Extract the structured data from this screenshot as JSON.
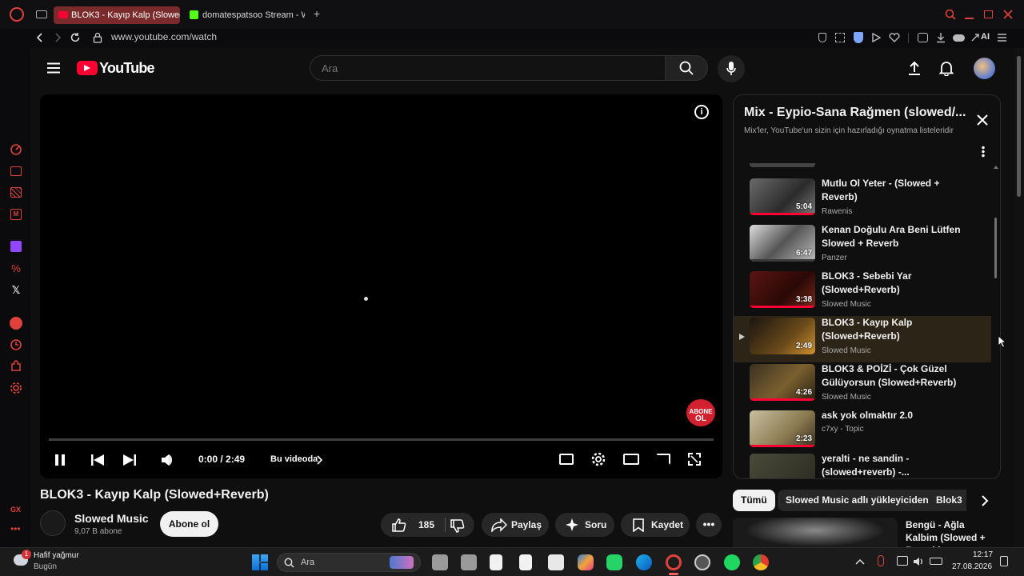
{
  "browser": {
    "tabs": [
      {
        "label": "BLOK3 - Kayıp Kalp (Slowed",
        "active": true
      },
      {
        "label": "domatespatsoo Stream - W",
        "active": false
      }
    ],
    "url": "www.youtube.com/watch",
    "ai_label": "AI"
  },
  "youtube": {
    "logo_text": "YouTube",
    "search_placeholder": "Ara"
  },
  "player": {
    "time": "0:00 / 2:49",
    "chapter_label": "Bu videoda",
    "watermark_line1": "ABONE",
    "watermark_line2": "OL"
  },
  "video": {
    "title": "BLOK3 - Kayıp Kalp (Slowed+Reverb)",
    "channel": "Slowed Music",
    "subscribers": "9,07 B abone",
    "subscribe_label": "Abone ol",
    "likes": "185",
    "share_label": "Paylaş",
    "ask_label": "Soru",
    "save_label": "Kaydet"
  },
  "playlist": {
    "title": "Mix - Eypio-Sana Rağmen (slowed/...",
    "subtitle": "Mix'ler, YouTube'un sizin için hazırladığı oynatma listeleridir",
    "items": [
      {
        "title": "Mutlu Ol Yeter - (Slowed + Reverb)",
        "channel": "Rawenis",
        "duration": "5:04",
        "current": false
      },
      {
        "title": "Kenan Doğulu Ara Beni Lütfen Slowed + Reverb",
        "channel": "Panzer",
        "duration": "6:47",
        "current": false
      },
      {
        "title": "BLOK3 - Sebebi Yar (Slowed+Reverb)",
        "channel": "Slowed Music",
        "duration": "3:38",
        "current": false
      },
      {
        "title": "BLOK3 - Kayıp Kalp (Slowed+Reverb)",
        "channel": "Slowed Music",
        "duration": "2:49",
        "current": true
      },
      {
        "title": "BLOK3 & POİZİ - Çok Güzel Gülüyorsun (Slowed+Reverb)",
        "channel": "Slowed Music",
        "duration": "4:26",
        "current": false
      },
      {
        "title": "ask yok olmaktır 2.0",
        "channel": "c7xy - Topic",
        "duration": "2:23",
        "current": false
      },
      {
        "title": "yeralti - ne sandin - (slowed+reverb) -...",
        "channel": "",
        "duration": "",
        "current": false
      }
    ]
  },
  "chips": [
    "Tümü",
    "Slowed Music adlı yükleyiciden",
    "Blok3"
  ],
  "recommendation": {
    "title": "Bengü - Ağla Kalbim (Slowed + Reverb)"
  },
  "taskbar": {
    "weather_title": "Hafif yağmur",
    "weather_sub": "Bugün",
    "weather_badge": "1",
    "search_label": "Ara",
    "time": "12:17",
    "date": "27.08.2026"
  },
  "sidebar_label": "GX",
  "colors": {
    "accent": "#ff0033",
    "opera": "#e0413a",
    "current_row": "#2c2416"
  }
}
